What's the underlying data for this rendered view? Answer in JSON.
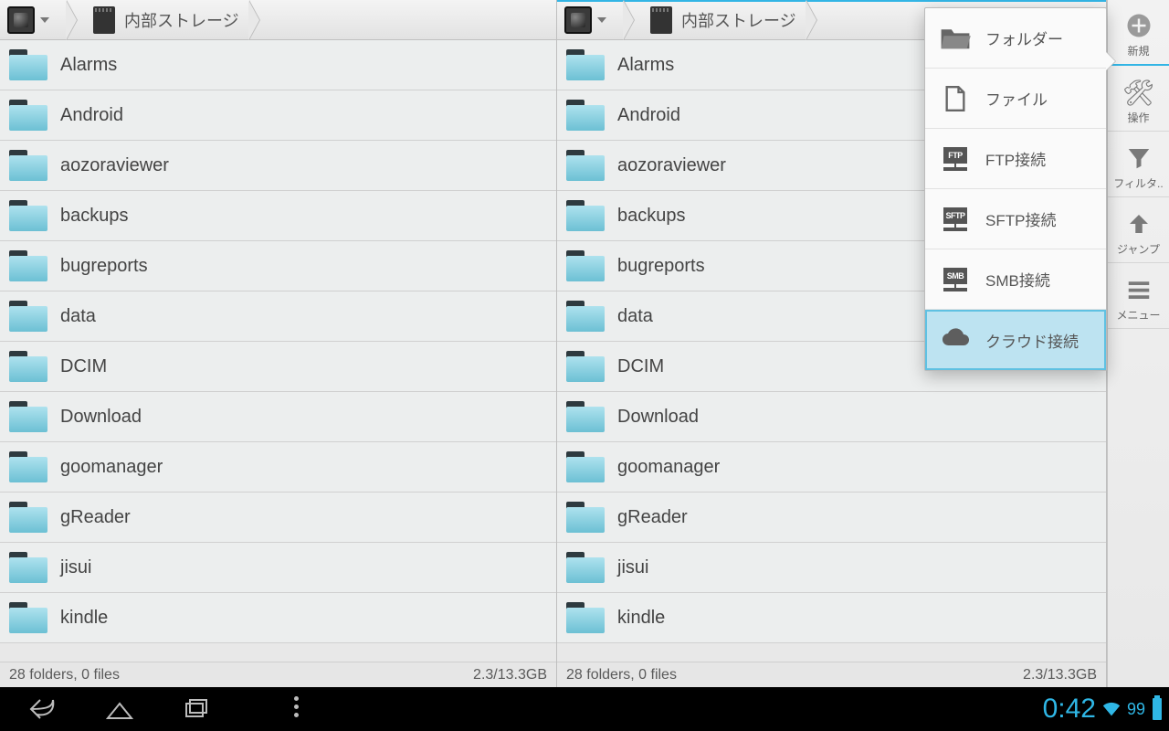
{
  "breadcrumb": {
    "location": "内部ストレージ"
  },
  "folders": [
    "Alarms",
    "Android",
    "aozoraviewer",
    "backups",
    "bugreports",
    "data",
    "DCIM",
    "Download",
    "goomanager",
    "gReader",
    "jisui",
    "kindle"
  ],
  "status": {
    "summary": "28 folders, 0 files",
    "space": "2.3/13.3GB"
  },
  "menu": {
    "folder": "フォルダー",
    "file": "ファイル",
    "ftp": "FTP接続",
    "sftp": "SFTP接続",
    "smb": "SMB接続",
    "cloud": "クラウド接続"
  },
  "sidebar": {
    "new_": "新規",
    "ops": "操作",
    "filter": "フィルタ..",
    "jump": "ジャンプ",
    "menu": "メニュー"
  },
  "navbar": {
    "clock": "0:42",
    "battery_pct": "99"
  }
}
